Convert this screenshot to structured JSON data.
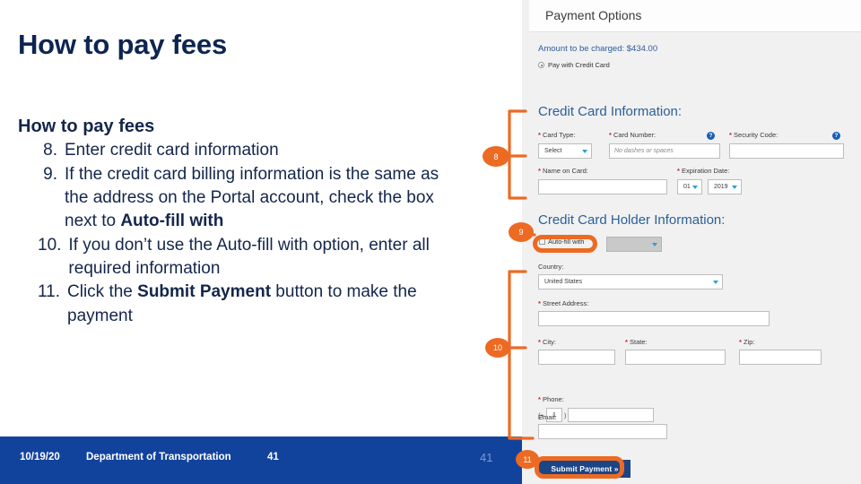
{
  "slide": {
    "title": "How to pay fees",
    "body_heading": "How to pay fees",
    "steps": [
      {
        "num": "8.",
        "text_before": "Enter credit card information",
        "bold": "",
        "text_after": ""
      },
      {
        "num": "9.",
        "text_before": "If the credit card billing information is the same as the address on the Portal account, check the box next to ",
        "bold": "Auto-fill with",
        "text_after": ""
      },
      {
        "num": "10.",
        "text_before": "If you don’t use the Auto-fill with option, enter all required information",
        "bold": "",
        "text_after": ""
      },
      {
        "num": "11.",
        "text_before": "Click the ",
        "bold": "Submit Payment",
        "text_after": " button to make the payment"
      }
    ]
  },
  "footer": {
    "date": "10/19/20",
    "org": "Department of Transportation",
    "number": "41",
    "page": "41",
    "bar_color": "#12439c"
  },
  "app": {
    "header_title": "Payment Options",
    "amount_line": "Amount to be charged: $434.00",
    "pay_radio_label": "Pay with Credit Card",
    "cc_info_heading": "Credit Card Information:",
    "cc_holder_heading": "Credit Card Holder Information:",
    "labels": {
      "card_type": "Card Type:",
      "card_number": "Card Number:",
      "security_code": "Security Code:",
      "name_on_card": "Name on Card:",
      "expiration_date": "Expiration Date:",
      "country": "Country:",
      "street_address": "Street Address:",
      "city": "City:",
      "state": "State:",
      "zip": "Zip:",
      "phone": "Phone:",
      "email": "Email:"
    },
    "values": {
      "card_type": "Select",
      "card_number_placeholder": "No dashes or spaces",
      "security_code": "",
      "name_on_card": "",
      "exp_month": "01",
      "exp_year": "2019",
      "autofill_label": "Auto-fill with",
      "autofill_select": "",
      "country": "United States",
      "street_address": "",
      "city": "",
      "state": "",
      "zip": "",
      "phone_paren_left": "(+",
      "phone_country_code": "1",
      "phone_paren_right": ")",
      "phone_number": "",
      "email": ""
    },
    "help_icon_glyph": "?",
    "required_marker": "*",
    "submit_label": "Submit Payment »",
    "accent_color": "#2a6099",
    "button_color": "#1c4587"
  },
  "callouts": {
    "badges": [
      "8",
      "9",
      "10",
      "11"
    ],
    "color": "#ed6a23"
  }
}
